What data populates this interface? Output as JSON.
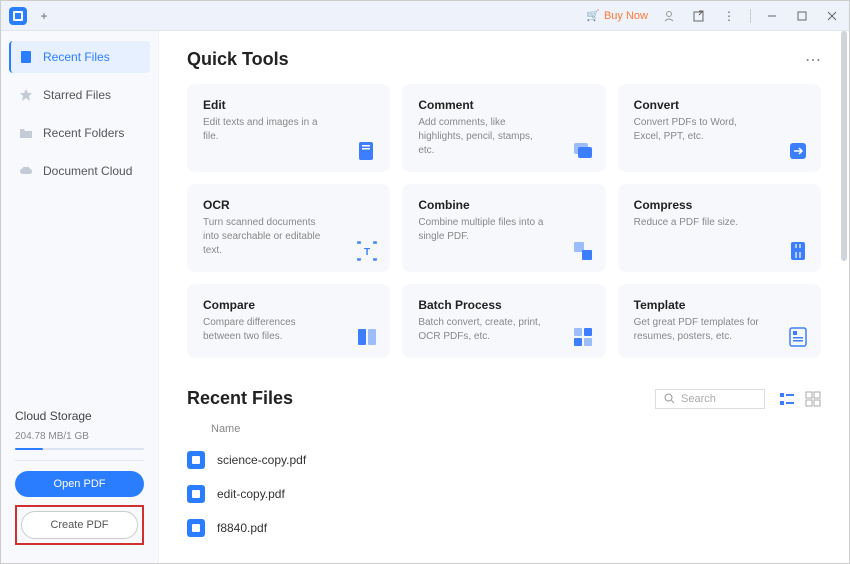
{
  "titlebar": {
    "buy_now": "Buy Now"
  },
  "sidebar": {
    "items": [
      {
        "label": "Recent Files",
        "active": true
      },
      {
        "label": "Starred Files",
        "active": false
      },
      {
        "label": "Recent Folders",
        "active": false
      },
      {
        "label": "Document Cloud",
        "active": false
      }
    ],
    "cloud_title": "Cloud Storage",
    "cloud_usage": "204.78 MB/1 GB",
    "open_pdf_label": "Open PDF",
    "create_pdf_label": "Create PDF"
  },
  "quick_tools": {
    "title": "Quick Tools",
    "cards": [
      {
        "title": "Edit",
        "desc": "Edit texts and images in a file."
      },
      {
        "title": "Comment",
        "desc": "Add comments, like highlights, pencil, stamps, etc."
      },
      {
        "title": "Convert",
        "desc": "Convert PDFs to Word, Excel, PPT, etc."
      },
      {
        "title": "OCR",
        "desc": "Turn scanned documents into searchable or editable text."
      },
      {
        "title": "Combine",
        "desc": "Combine multiple files into a single PDF."
      },
      {
        "title": "Compress",
        "desc": "Reduce a PDF file size."
      },
      {
        "title": "Compare",
        "desc": "Compare differences between two files."
      },
      {
        "title": "Batch Process",
        "desc": "Batch convert, create, print, OCR PDFs, etc."
      },
      {
        "title": "Template",
        "desc": "Get great PDF templates for resumes, posters, etc."
      }
    ]
  },
  "recent": {
    "title": "Recent Files",
    "search_placeholder": "Search",
    "col_name": "Name",
    "files": [
      {
        "name": "science-copy.pdf"
      },
      {
        "name": "edit-copy.pdf"
      },
      {
        "name": "f8840.pdf"
      }
    ]
  }
}
